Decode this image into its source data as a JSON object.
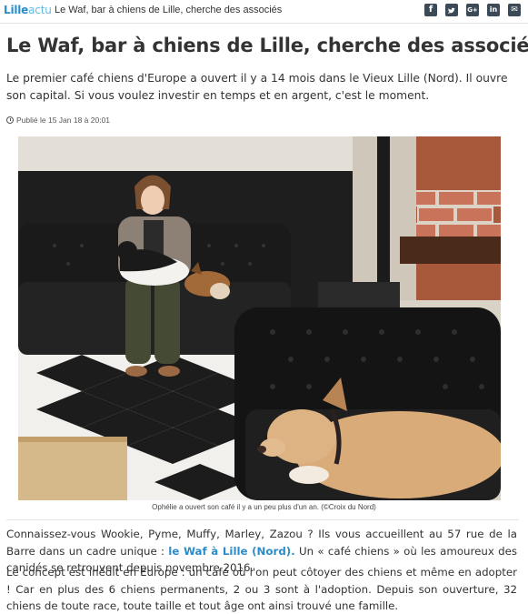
{
  "site": {
    "logo_part1": "Lille",
    "logo_part2": "actu",
    "page_title": "Le Waf, bar à chiens de Lille, cherche des associés"
  },
  "share": {
    "facebook": "f",
    "twitter": "t",
    "google": "G+",
    "linkedin": "in",
    "email": "✉"
  },
  "article": {
    "headline": "Le Waf, bar à chiens de Lille, cherche des associés",
    "lead": "Le premier café chiens d'Europe a ouvert il y a 14 mois dans le Vieux Lille (Nord). Il ouvre son capital. Si vous voulez investir en temps et en argent, c'est le moment.",
    "published": "Publié le 15 Jan 18 à 20:01",
    "photo_caption": "Ophélie a ouvert son café il y a un peu plus d'un an. (©Croix du Nord)",
    "p1_before": "Connaissez-vous Wookie, Pyme, Muffy, Marley, Zazou ? Ils vous accueillent au 57 rue de la Barre dans un cadre unique : ",
    "p1_link": "le Waf à Lille (Nord).",
    "p1_after": " Un « café chiens » où les amoureux des canidés se retrouvent depuis novembre 2016.",
    "p2": "Le concept est inédit en Europe : un café où l'on peut côtoyer des chiens et même en adopter ! Car en plus des 6 chiens permanents, 2 ou 3 sont à l'adoption. Depuis son ouverture, 32 chiens de toute race, toute taille et tout âge ont ainsi trouvé une famille."
  }
}
